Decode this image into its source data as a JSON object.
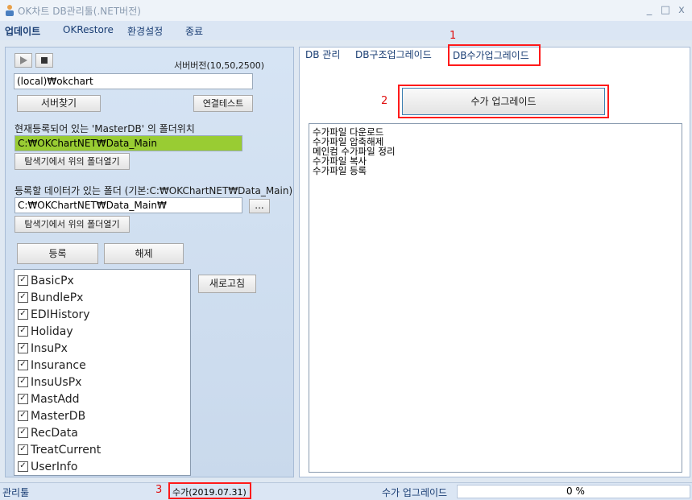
{
  "window": {
    "title": "OK차트 DB관리툴(.NET버전)",
    "minimize": "_",
    "maximize": "□",
    "close": "x"
  },
  "menu": [
    "업데이트",
    "OKRestore",
    "환경설정",
    "종료"
  ],
  "left": {
    "server_version": "서버버전(10,50,2500)",
    "server_input": "(local)₩okchart",
    "find_server": "서버찾기",
    "test_connection": "연결테스트",
    "master_label": "현재등록되어 있는 'MasterDB' 의 폴더위치",
    "master_path": "C:₩OKChartNET₩Data_Main",
    "open_explorer_1": "탐색기에서 위의 폴더열기",
    "register_folder_label": "등록할 데이터가 있는 폴더 (기본:C:₩OKChartNET₩Data_Main)",
    "register_path": "C:₩OKChartNET₩Data_Main₩",
    "browse": "...",
    "open_explorer_2": "탐색기에서 위의 폴더열기",
    "register": "등록",
    "unregister": "해제",
    "refresh": "새로고침",
    "db_list": [
      "BasicPx",
      "BundlePx",
      "EDIHistory",
      "Holiday",
      "InsuPx",
      "Insurance",
      "InsuUsPx",
      "MastAdd",
      "MasterDB",
      "RecData",
      "TreatCurrent",
      "UserInfo"
    ]
  },
  "tabs": [
    "DB 관리",
    "DB구조업그레이드",
    "DB수가업그레이드"
  ],
  "right": {
    "upgrade_button": "수가 업그레이드",
    "log": [
      "수가파일 다운로드",
      "수가파일 압축해제",
      "메인컴 수가파일 정리",
      "수가파일 복사",
      "수가파일 등록"
    ]
  },
  "annotations": [
    "1",
    "2",
    "3"
  ],
  "status": {
    "left": "관리툴",
    "version": "수가(2019.07.31)",
    "task": "수가 업그레이드",
    "progress": "0 %"
  },
  "colors": {
    "highlight": "#99cc33",
    "annotation": "#ff1a1a"
  }
}
